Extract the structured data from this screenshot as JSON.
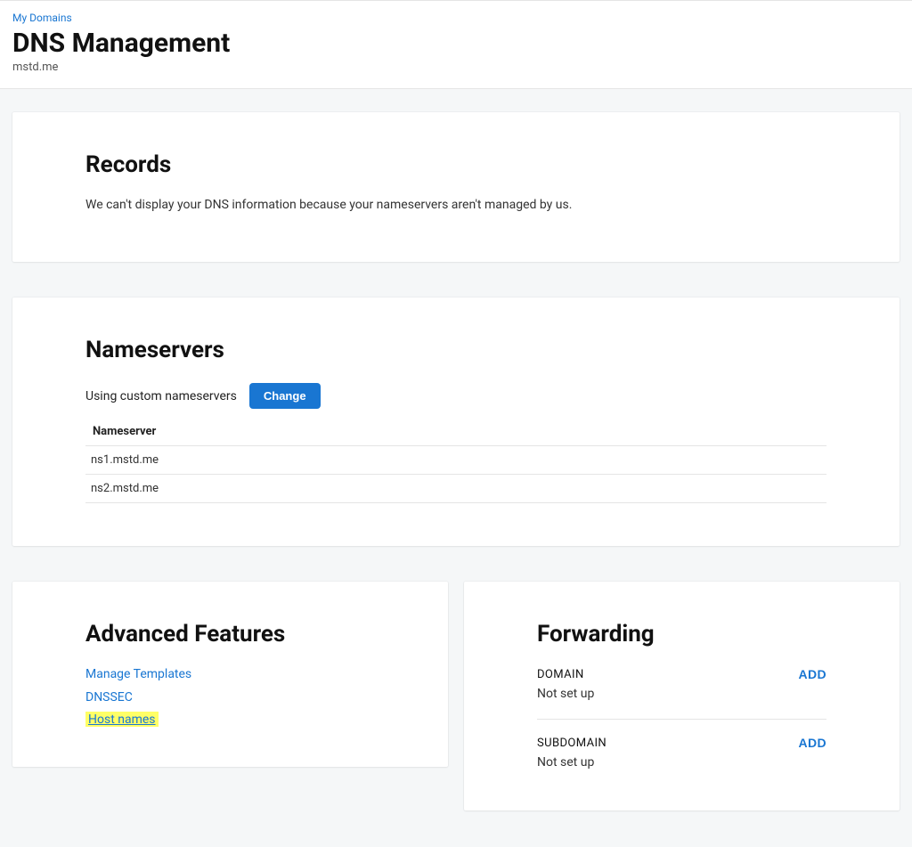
{
  "breadcrumb": {
    "label": "My Domains"
  },
  "page_title": "DNS Management",
  "domain": "mstd.me",
  "records": {
    "title": "Records",
    "message": "We can't display your DNS information because your nameservers aren't managed by us."
  },
  "nameservers": {
    "title": "Nameservers",
    "status": "Using custom nameservers",
    "change_label": "Change",
    "table_header": "Nameserver",
    "entries": [
      "ns1.mstd.me",
      "ns2.mstd.me"
    ]
  },
  "advanced": {
    "title": "Advanced Features",
    "links": {
      "manage_templates": "Manage Templates",
      "dnssec": "DNSSEC",
      "host_names": "Host names"
    }
  },
  "forwarding": {
    "title": "Forwarding",
    "domain": {
      "label": "DOMAIN",
      "status": "Not set up",
      "add_label": "ADD"
    },
    "subdomain": {
      "label": "SUBDOMAIN",
      "status": "Not set up",
      "add_label": "ADD"
    }
  }
}
